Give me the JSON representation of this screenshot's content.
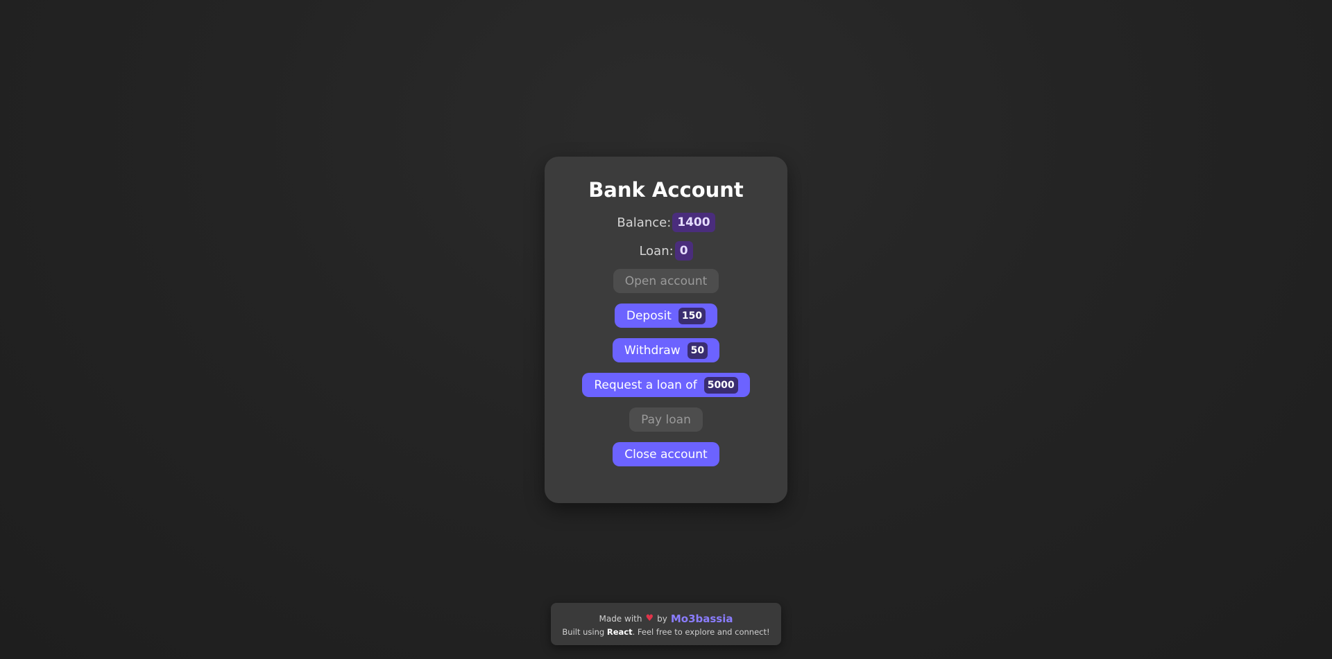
{
  "account": {
    "title": "Bank Account",
    "balance_label": "Balance:",
    "balance_value": "1400",
    "loan_label": "Loan:",
    "loan_value": "0"
  },
  "actions": {
    "open_account": "Open account",
    "deposit_label": "Deposit",
    "deposit_amount": "150",
    "withdraw_label": "Withdraw",
    "withdraw_amount": "50",
    "request_loan_label": "Request a loan of",
    "request_loan_amount": "5000",
    "pay_loan": "Pay loan",
    "close_account": "Close account"
  },
  "footer": {
    "made_with": "Made with",
    "heart": "♥",
    "by": "by",
    "author": "Mo3bassia",
    "built_using": "Built using",
    "tech": "React",
    "tail": ". Feel free to explore and connect!"
  },
  "colors": {
    "accent": "#6c63ff",
    "badge": "#4a2d7c",
    "card": "#3c3c3c",
    "disabled": "#4d4d4d",
    "heart": "#e0344a"
  },
  "icons": {
    "heart": "heart-icon"
  }
}
